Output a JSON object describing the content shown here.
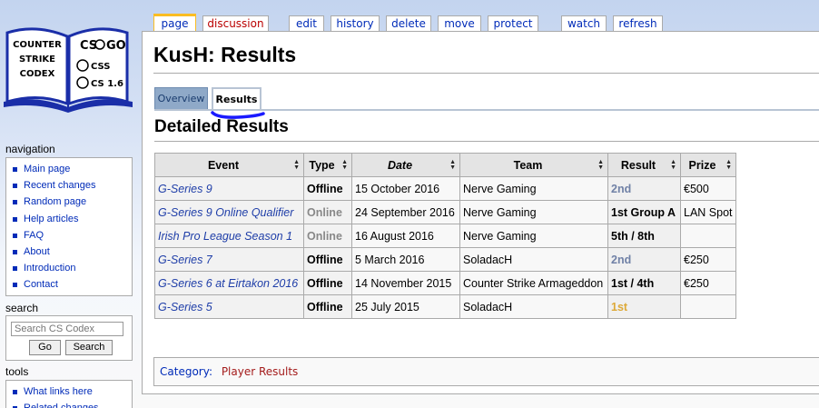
{
  "logo": {
    "left_text": [
      "COUNTER",
      "STRIKE",
      "CODEX"
    ],
    "right_items": [
      "CS",
      "GO",
      "CSS",
      "CS 1.6"
    ]
  },
  "tabs": [
    {
      "id": "page",
      "label": "page"
    },
    {
      "id": "discussion",
      "label": "discussion"
    },
    {
      "id": "edit",
      "label": "edit"
    },
    {
      "id": "history",
      "label": "history"
    },
    {
      "id": "delete",
      "label": "delete"
    },
    {
      "id": "move",
      "label": "move"
    },
    {
      "id": "protect",
      "label": "protect"
    },
    {
      "id": "watch",
      "label": "watch"
    },
    {
      "id": "refresh",
      "label": "refresh"
    }
  ],
  "page_title": "KusH: Results",
  "subtabs": {
    "overview": "Overview",
    "results": "Results"
  },
  "section_title": "Detailed Results",
  "table": {
    "headers": [
      "Event",
      "Type",
      "Date",
      "Team",
      "Result",
      "Prize"
    ],
    "rows": [
      {
        "event": "G-Series 9",
        "type": "Offline",
        "date": "15 October 2016",
        "team": "Nerve Gaming",
        "result": "2nd",
        "prize": "€500"
      },
      {
        "event": "G-Series 9 Online Qualifier",
        "type": "Online",
        "date": "24 September 2016",
        "team": "Nerve Gaming",
        "result": "1st Group A",
        "prize": "LAN Spot"
      },
      {
        "event": "Irish Pro League Season 1",
        "type": "Online",
        "date": "16 August 2016",
        "team": "Nerve Gaming",
        "result": "5th / 8th",
        "prize": ""
      },
      {
        "event": "G-Series 7",
        "type": "Offline",
        "date": "5 March 2016",
        "team": "SoladacH",
        "result": "2nd",
        "prize": "€250"
      },
      {
        "event": "G-Series 6 at Eirtakon 2016",
        "type": "Offline",
        "date": "14 November 2015",
        "team": "Counter Strike Armageddon",
        "result": "1st / 4th",
        "prize": "€250"
      },
      {
        "event": "G-Series 5",
        "type": "Offline",
        "date": "25 July 2015",
        "team": "SoladacH",
        "result": "1st",
        "prize": ""
      }
    ]
  },
  "category": {
    "label": "Category:",
    "item": "Player Results"
  },
  "navigation": {
    "title": "navigation",
    "items": [
      "Main page",
      "Recent changes",
      "Random page",
      "Help articles",
      "FAQ",
      "About",
      "Introduction",
      "Contact"
    ]
  },
  "search": {
    "title": "search",
    "placeholder": "Search CS Codex",
    "go_label": "Go",
    "search_label": "Search"
  },
  "tools": {
    "title": "tools",
    "items": [
      "What links here",
      "Related changes"
    ]
  },
  "colors": {
    "link": "#002bb8",
    "new_link": "#ba0000",
    "selected_tab_border": "#fabd23",
    "silver_result": "#7081a6",
    "gold_result": "#dda938"
  }
}
